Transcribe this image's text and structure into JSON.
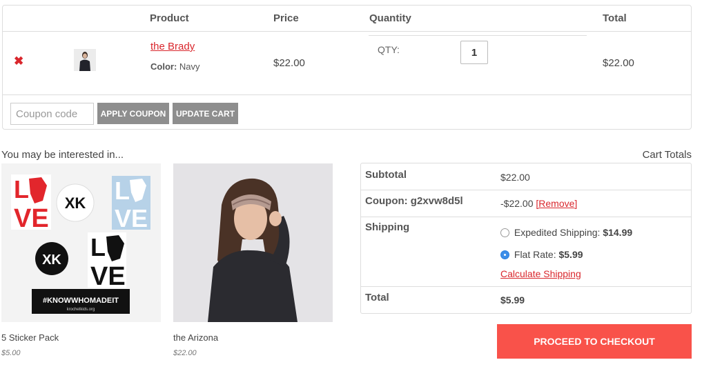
{
  "cart": {
    "headers": {
      "product": "Product",
      "price": "Price",
      "quantity": "Quantity",
      "total": "Total"
    },
    "item": {
      "name": "the Brady",
      "color_label": "Color:",
      "color_value": "Navy",
      "price": "$22.00",
      "qty_label": "QTY:",
      "qty": "1",
      "total": "$22.00"
    },
    "remove_icon": "✖",
    "coupon_placeholder": "Coupon code",
    "apply_coupon": "APPLY COUPON",
    "update_cart": "UPDATE CART"
  },
  "related": {
    "title": "You may be interested in...",
    "products": [
      {
        "name": "5 Sticker Pack",
        "price": "$5.00"
      },
      {
        "name": "the Arizona",
        "price": "$22.00"
      }
    ],
    "sticker_text": {
      "love_l": "L",
      "love_ve": "VE",
      "logo": "XK",
      "banner": "#KNOWWHOMADEIT",
      "banner_sub": "krochetkids.org"
    }
  },
  "totals": {
    "title": "Cart Totals",
    "subtotal_label": "Subtotal",
    "subtotal_value": "$22.00",
    "coupon_label": "Coupon: g2xvw8d5l",
    "coupon_value": "-$22.00",
    "coupon_remove": "[Remove]",
    "shipping_label": "Shipping",
    "shipping_options": [
      {
        "label": "Expedited Shipping:",
        "price": "$14.99",
        "selected": false
      },
      {
        "label": "Flat Rate:",
        "price": "$5.99",
        "selected": true
      }
    ],
    "calculate_shipping": "Calculate Shipping",
    "total_label": "Total",
    "total_value": "$5.99",
    "checkout": "PROCEED TO CHECKOUT"
  },
  "colors": {
    "accent_red": "#d9262c",
    "checkout_bg": "#f9524a",
    "grey_button": "#8e8e8e",
    "radio_blue": "#3b8de8"
  }
}
